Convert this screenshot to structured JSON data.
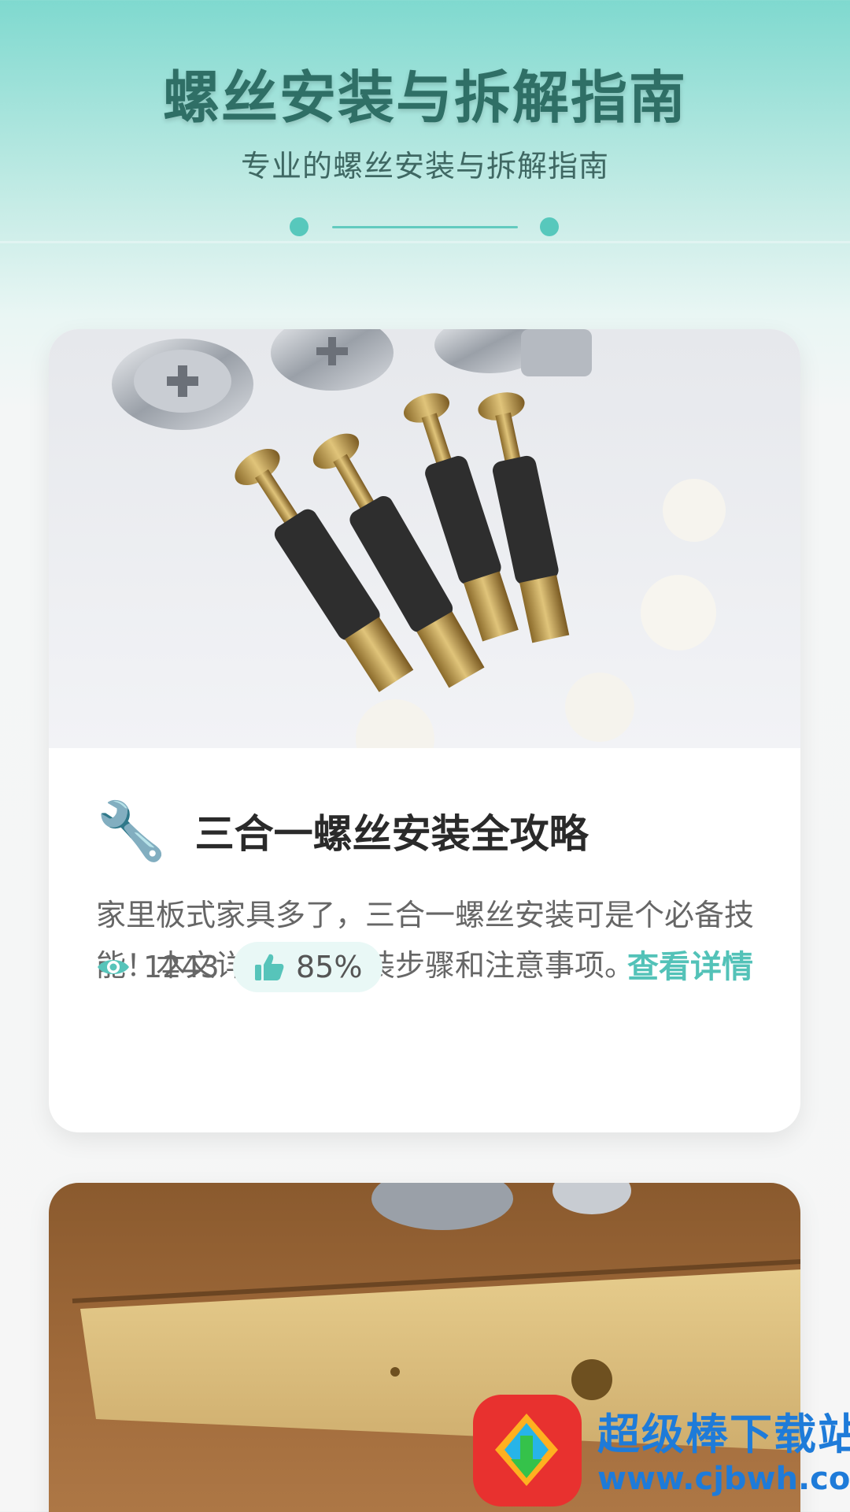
{
  "header": {
    "title": "螺丝安装与拆解指南",
    "subtitle": "专业的螺丝安装与拆解指南"
  },
  "articles": [
    {
      "image_icon": "fasteners-photo",
      "title_icon": "wrench-icon",
      "title": "三合一螺丝安装全攻略",
      "description": "家里板式家具多了，三合一螺丝安装可是个必备技能！本文详细介绍安装步骤和注意事项。",
      "views": "1243",
      "likes": "85%",
      "details_label": "查看详情"
    },
    {
      "image_icon": "wood-board-photo"
    }
  ],
  "watermark": {
    "name": "超级棒下载站",
    "url": "www.cjbwh.com"
  },
  "colors": {
    "accent": "#53c2b8",
    "header_top": "#7fd9cf",
    "title": "#2f6f66"
  }
}
